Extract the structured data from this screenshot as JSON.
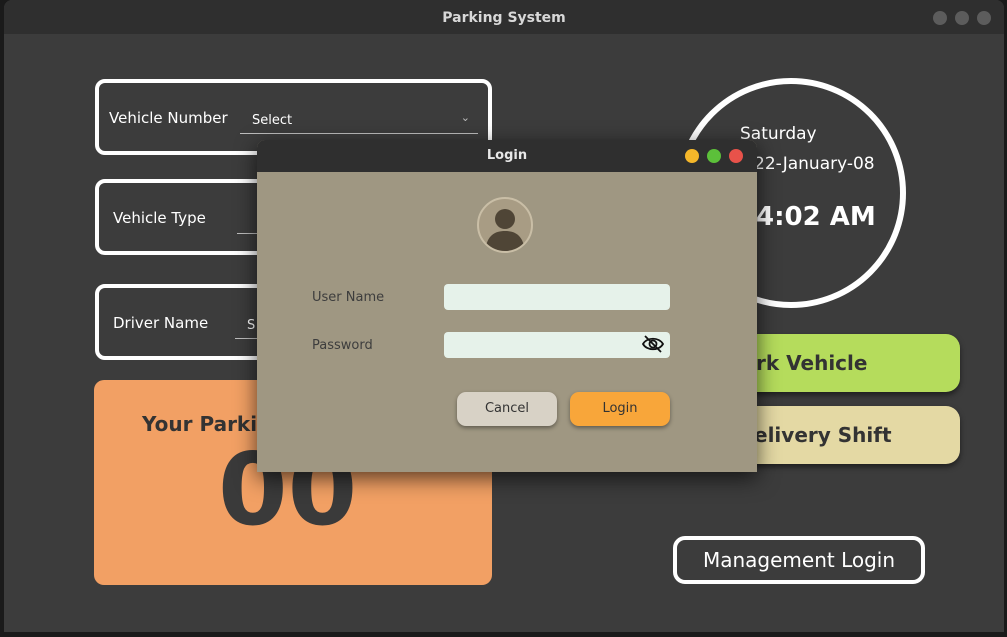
{
  "window": {
    "title": "Parking System"
  },
  "form": {
    "vehicle_number": {
      "label": "Vehicle Number",
      "value": "Select"
    },
    "vehicle_type": {
      "label": "Vehicle Type",
      "value": ""
    },
    "driver_name": {
      "label": "Driver Name",
      "value": "S"
    }
  },
  "parking": {
    "title": "Your Parki",
    "number": "00"
  },
  "clock": {
    "day": "Saturday",
    "date": "22-January-08",
    "time": "4:02 AM"
  },
  "actions": {
    "park_vehicle": "rk Vehicle",
    "delivery_shift": "elivery Shift",
    "management_login": "Management Login"
  },
  "login_dialog": {
    "title": "Login",
    "username_label": "User Name",
    "username_value": "",
    "password_label": "Password",
    "password_value": "",
    "cancel": "Cancel",
    "login": "Login"
  },
  "colors": {
    "parking_card": "#f2a064",
    "park_button": "#b5dc5c",
    "delivery_button": "#e4d9a4",
    "login_button": "#f8a63a",
    "cancel_button": "#d8d2c6",
    "dialog_bg": "#9f9782",
    "dot_yellow": "#f5b72a",
    "dot_green": "#5cc03a",
    "dot_red": "#e8524a"
  }
}
